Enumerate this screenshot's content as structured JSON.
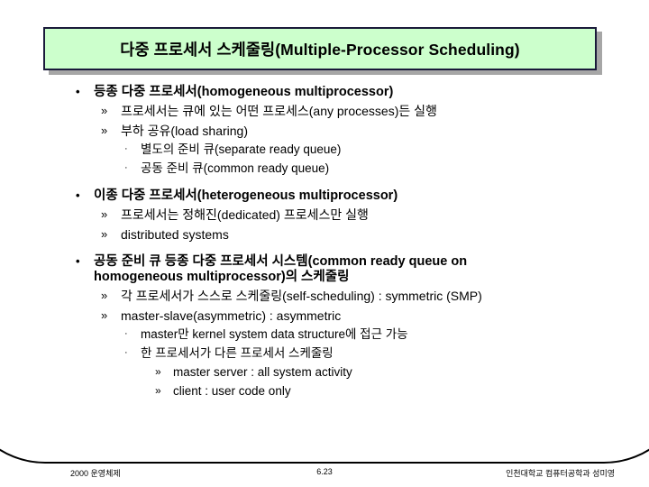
{
  "slide": {
    "title": "다중 프로세서 스케줄링(Multiple-Processor Scheduling)",
    "title_bg_color": "#ccffcc",
    "title_border_color": "#1a1a3a",
    "bullet_glyphs": {
      "level1": "•",
      "level2": "»",
      "level3": "·",
      "level4": "»"
    }
  },
  "outline": [
    {
      "level": 1,
      "text": "등종 다중 프로세서(homogeneous multiprocessor)"
    },
    {
      "level": 2,
      "text": "프로세서는 큐에 있는 어떤 프로세스(any processes)든 실행"
    },
    {
      "level": 2,
      "text": "부하 공유(load sharing)"
    },
    {
      "level": 3,
      "text": "별도의 준비 큐(separate ready queue)"
    },
    {
      "level": 3,
      "text": "공동 준비 큐(common ready queue)"
    },
    {
      "level": 1,
      "text": "이종 다중 프로세서(heterogeneous multiprocessor)"
    },
    {
      "level": 2,
      "text": "프로세서는 정해진(dedicated) 프로세스만 실행"
    },
    {
      "level": 2,
      "text": "distributed systems"
    },
    {
      "level": 1,
      "text": "공동 준비 큐 등종 다중 프로세서 시스템(common ready queue on homogeneous multiprocessor)의 스케줄링"
    },
    {
      "level": 2,
      "text": "각 프로세서가 스스로 스케줄링(self-scheduling) : symmetric (SMP)"
    },
    {
      "level": 2,
      "text": "master-slave(asymmetric) : asymmetric"
    },
    {
      "level": 3,
      "text": "master만 kernel system data structure에 접근 가능"
    },
    {
      "level": 3,
      "text": "한 프로세서가 다른 프로세서 스케줄링"
    },
    {
      "level": 4,
      "text": "master server : all system activity"
    },
    {
      "level": 4,
      "text": "client : user code only"
    }
  ],
  "footer": {
    "left": "2000 운영체제",
    "center": "6.23",
    "right": "인천대학교 컴퓨터공학과 성미영"
  }
}
